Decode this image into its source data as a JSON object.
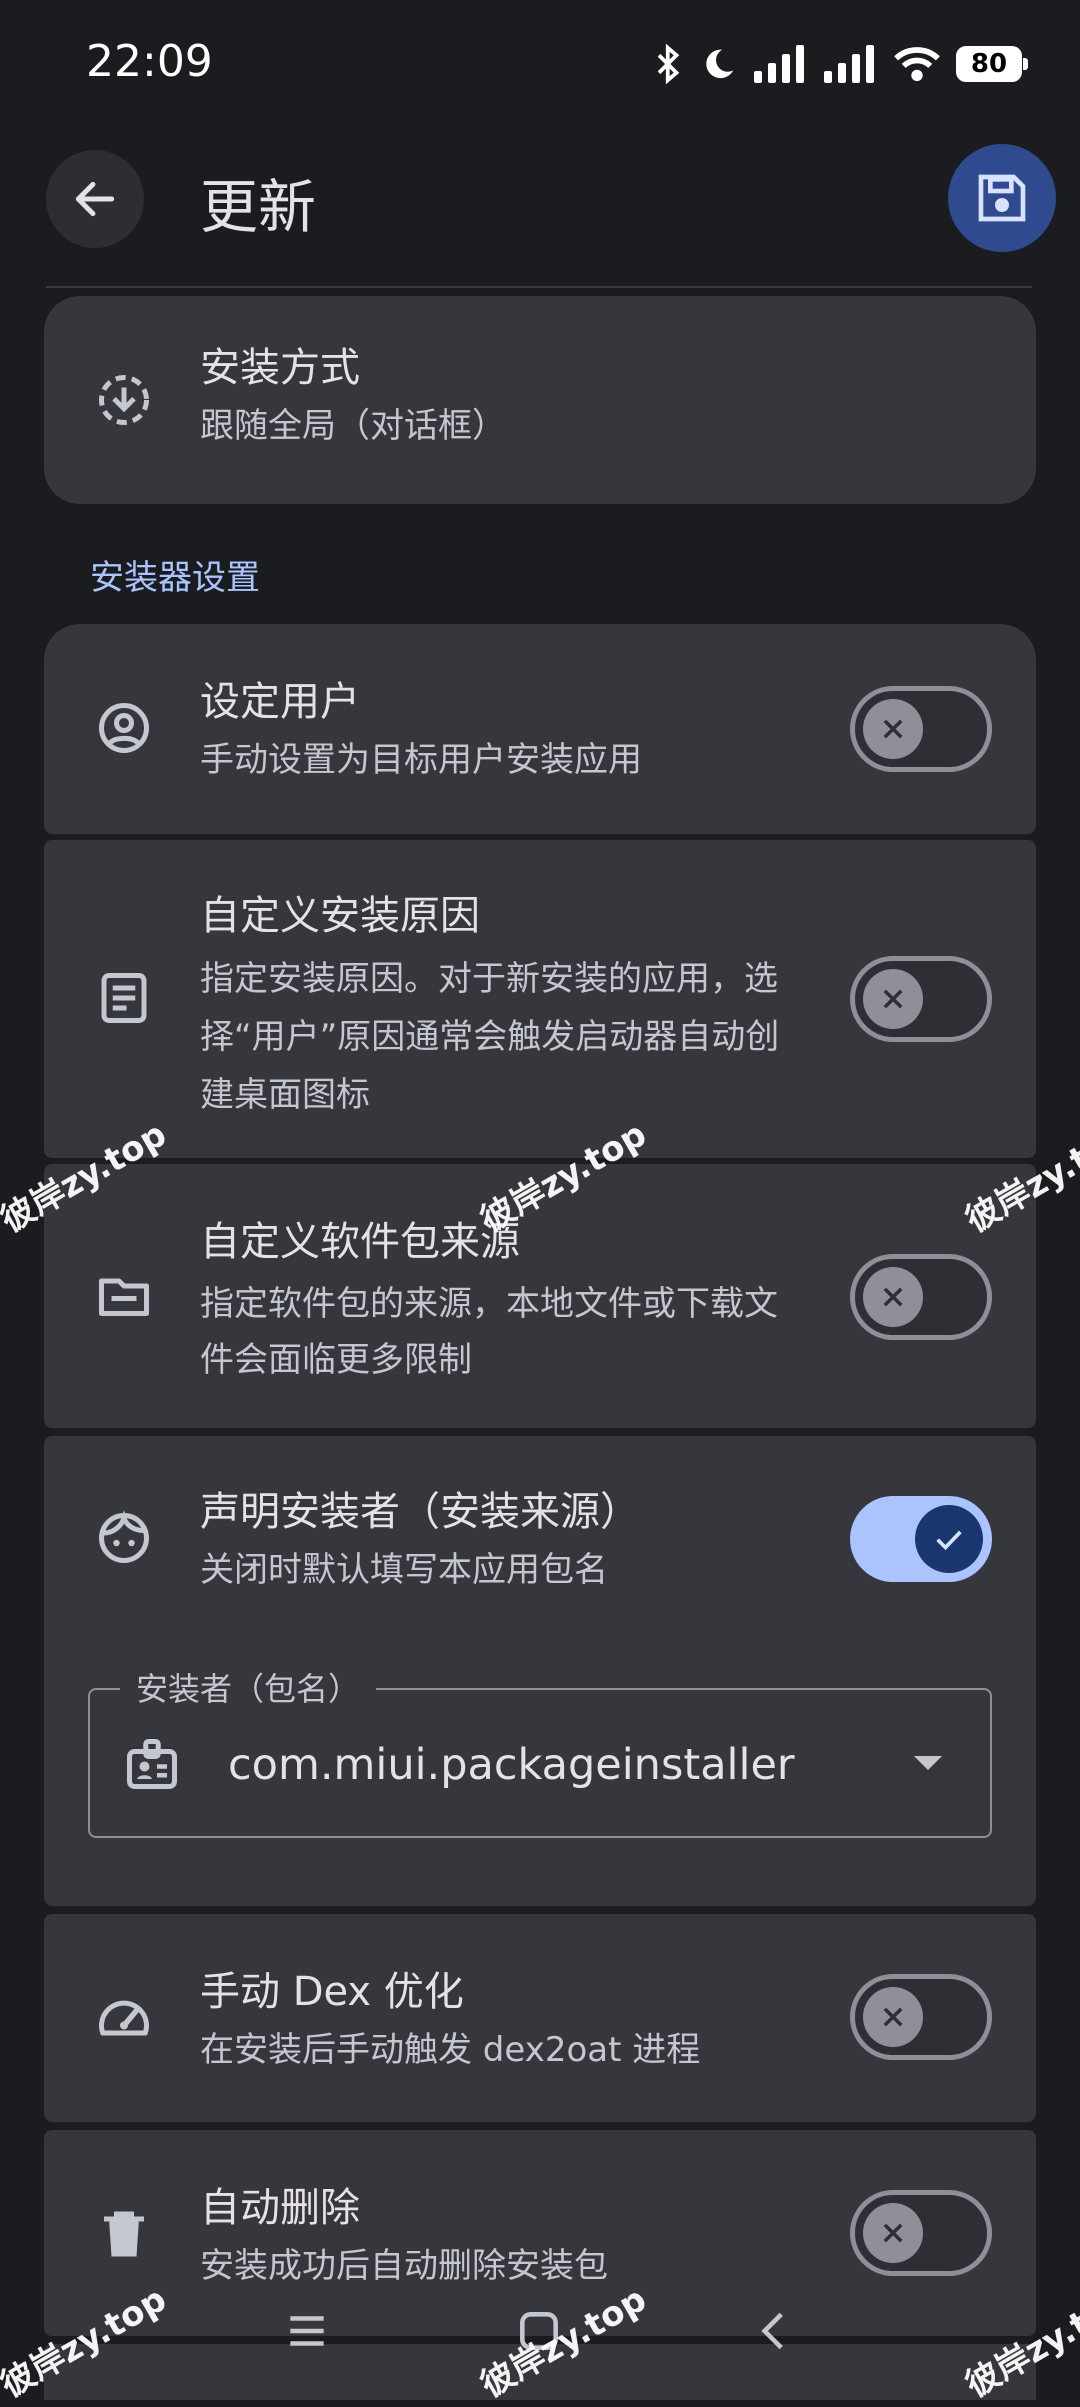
{
  "status_bar": {
    "time": "22:09",
    "battery": "80"
  },
  "app_bar": {
    "title": "更新"
  },
  "install_method": {
    "title": "安装方式",
    "summary": "跟随全局（对话框）"
  },
  "section": {
    "installer_settings": "安装器设置"
  },
  "settings": [
    {
      "title": "设定用户",
      "summary": "手动设置为目标用户安装应用",
      "enabled": false
    },
    {
      "title": "自定义安装原因",
      "summary": "指定安装原因。对于新安装的应用，选择“用户”原因通常会触发启动器自动创建桌面图标",
      "enabled": false
    },
    {
      "title": "自定义软件包来源",
      "summary": "指定软件包的来源，本地文件或下载文件会面临更多限制",
      "enabled": false
    },
    {
      "title": "声明安装者（安装来源）",
      "summary": "关闭时默认填写本应用包名",
      "enabled": true
    },
    {
      "title": "手动 Dex 优化",
      "summary": "在安装后手动触发 dex2oat 进程",
      "enabled": false
    },
    {
      "title": "自动删除",
      "summary": "安装成功后自动删除安装包",
      "enabled": false
    }
  ],
  "installer_field": {
    "label": "安装者（包名）",
    "value": "com.miui.packageinstaller"
  },
  "watermark": "彼岸zy.top",
  "colors": {
    "background": "#1b1c20",
    "card": "#36373c",
    "accent": "#abc3ff",
    "fab": "#2f4a8f"
  }
}
